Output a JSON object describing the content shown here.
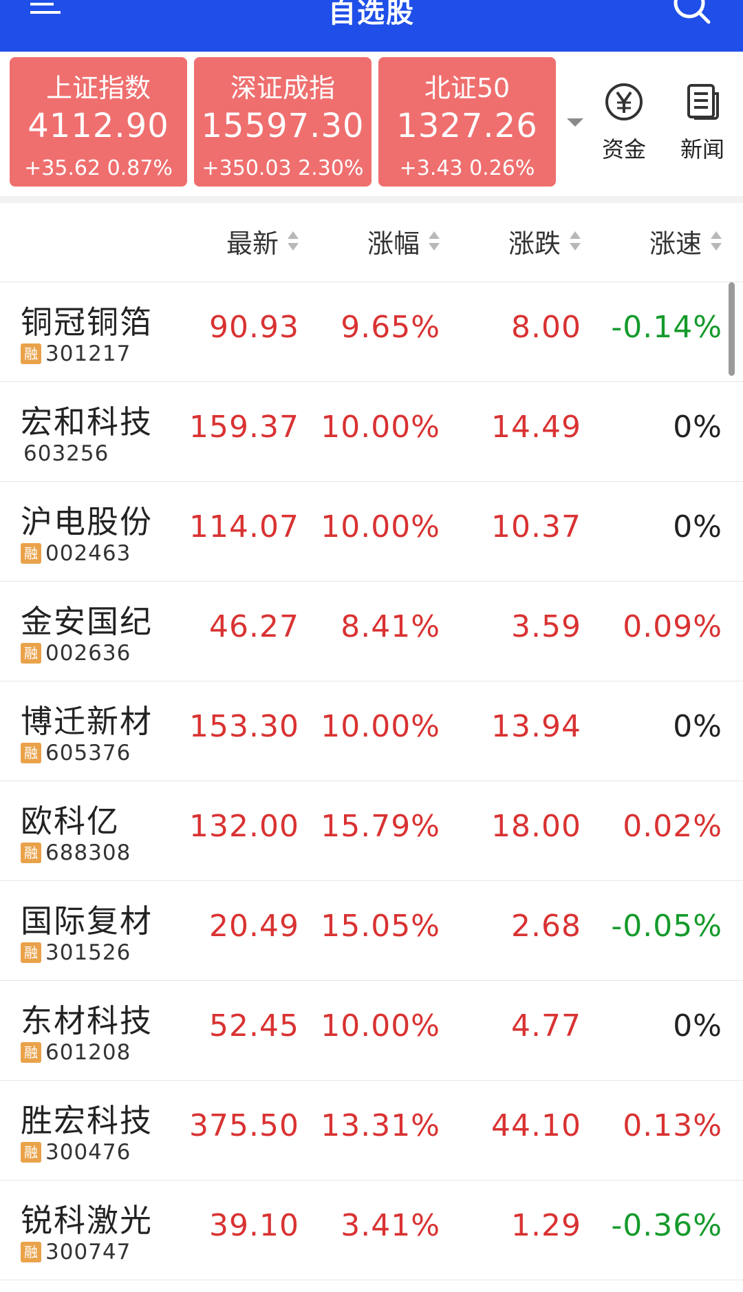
{
  "appbar": {
    "title": "自选股"
  },
  "indices": [
    {
      "name": "上证指数",
      "value": "4112.90",
      "change": "+35.62 0.87%"
    },
    {
      "name": "深证成指",
      "value": "15597.30",
      "change": "+350.03 2.30%"
    },
    {
      "name": "北证50",
      "value": "1327.26",
      "change": "+3.43 0.26%"
    }
  ],
  "quick_actions": {
    "funds_label": "资金",
    "news_label": "新闻"
  },
  "columns": {
    "price": "最新",
    "pct": "涨幅",
    "change": "涨跌",
    "speed": "涨速"
  },
  "badge_text": "融",
  "stocks": [
    {
      "name": "铜冠铜箔",
      "code": "301217",
      "margin": true,
      "price": "90.93",
      "pct": "9.65%",
      "change": "8.00",
      "speed": "-0.14%",
      "speed_tone": "green"
    },
    {
      "name": "宏和科技",
      "code": "603256",
      "margin": false,
      "price": "159.37",
      "pct": "10.00%",
      "change": "14.49",
      "speed": "0%",
      "speed_tone": "black"
    },
    {
      "name": "沪电股份",
      "code": "002463",
      "margin": true,
      "price": "114.07",
      "pct": "10.00%",
      "change": "10.37",
      "speed": "0%",
      "speed_tone": "black"
    },
    {
      "name": "金安国纪",
      "code": "002636",
      "margin": true,
      "price": "46.27",
      "pct": "8.41%",
      "change": "3.59",
      "speed": "0.09%",
      "speed_tone": "red"
    },
    {
      "name": "博迁新材",
      "code": "605376",
      "margin": true,
      "price": "153.30",
      "pct": "10.00%",
      "change": "13.94",
      "speed": "0%",
      "speed_tone": "black"
    },
    {
      "name": "欧科亿",
      "code": "688308",
      "margin": true,
      "price": "132.00",
      "pct": "15.79%",
      "change": "18.00",
      "speed": "0.02%",
      "speed_tone": "red"
    },
    {
      "name": "国际复材",
      "code": "301526",
      "margin": true,
      "price": "20.49",
      "pct": "15.05%",
      "change": "2.68",
      "speed": "-0.05%",
      "speed_tone": "green"
    },
    {
      "name": "东材科技",
      "code": "601208",
      "margin": true,
      "price": "52.45",
      "pct": "10.00%",
      "change": "4.77",
      "speed": "0%",
      "speed_tone": "black"
    },
    {
      "name": "胜宏科技",
      "code": "300476",
      "margin": true,
      "price": "375.50",
      "pct": "13.31%",
      "change": "44.10",
      "speed": "0.13%",
      "speed_tone": "red"
    },
    {
      "name": "锐科激光",
      "code": "300747",
      "margin": true,
      "price": "39.10",
      "pct": "3.41%",
      "change": "1.29",
      "speed": "-0.36%",
      "speed_tone": "green"
    }
  ],
  "colors": {
    "appbar": "#1f4fe8",
    "index_card": "#ef6f6f",
    "up": "#d93232",
    "down": "#159a2b",
    "flat": "#222222",
    "margin_badge": "#e9a24a"
  },
  "icons": {
    "menu": "menu-icon",
    "search": "search-icon",
    "funds": "yuan-coin-icon",
    "news": "news-icon",
    "dropdown": "chevron-down-icon",
    "sort": "sort-icon"
  }
}
